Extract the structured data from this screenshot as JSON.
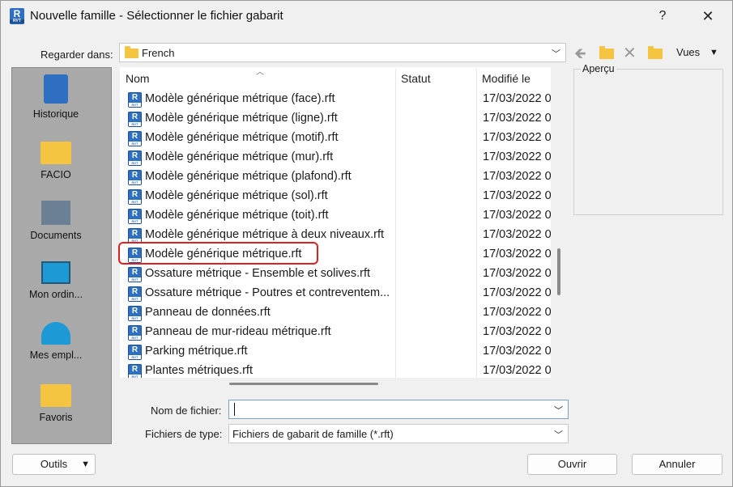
{
  "titlebar": {
    "title": "Nouvelle famille - Sélectionner le fichier gabarit",
    "help": "?",
    "close": "✕",
    "app_icon_letter": "R",
    "app_icon_sub": "RVT"
  },
  "lookin": {
    "label": "Regarder dans:",
    "value": "French"
  },
  "toolbar": {
    "views_label": "Vues"
  },
  "places": [
    {
      "label": "Historique",
      "icon": "history-icon"
    },
    {
      "label": "FACIO",
      "icon": "folder-icon"
    },
    {
      "label": "Documents",
      "icon": "documents-icon"
    },
    {
      "label": "Mon ordin...",
      "icon": "computer-icon"
    },
    {
      "label": "Mes empl...",
      "icon": "network-icon"
    },
    {
      "label": "Favoris",
      "icon": "folder-icon"
    }
  ],
  "columns": {
    "name": "Nom",
    "status": "Statut",
    "modified": "Modifié le"
  },
  "files": [
    {
      "name": "Modèle générique métrique (face).rft",
      "date": "17/03/2022 0"
    },
    {
      "name": "Modèle générique métrique (ligne).rft",
      "date": "17/03/2022 0"
    },
    {
      "name": "Modèle générique métrique (motif).rft",
      "date": "17/03/2022 0"
    },
    {
      "name": "Modèle générique métrique (mur).rft",
      "date": "17/03/2022 0"
    },
    {
      "name": "Modèle générique métrique (plafond).rft",
      "date": "17/03/2022 0"
    },
    {
      "name": "Modèle générique métrique (sol).rft",
      "date": "17/03/2022 0"
    },
    {
      "name": "Modèle générique métrique (toit).rft",
      "date": "17/03/2022 0"
    },
    {
      "name": "Modèle générique métrique à deux niveaux.rft",
      "date": "17/03/2022 0"
    },
    {
      "name": "Modèle générique métrique.rft",
      "date": "17/03/2022 0"
    },
    {
      "name": "Ossature métrique - Ensemble et solives.rft",
      "date": "17/03/2022 0"
    },
    {
      "name": "Ossature métrique - Poutres et contreventem...",
      "date": "17/03/2022 0"
    },
    {
      "name": "Panneau de données.rft",
      "date": "17/03/2022 0"
    },
    {
      "name": "Panneau de mur-rideau métrique.rft",
      "date": "17/03/2022 0"
    },
    {
      "name": "Parking métrique.rft",
      "date": "17/03/2022 0"
    },
    {
      "name": "Plantes métriques.rft",
      "date": "17/03/2022 0"
    }
  ],
  "preview": {
    "label": "Aperçu"
  },
  "filename": {
    "label": "Nom de fichier:",
    "value": ""
  },
  "filetype": {
    "label": "Fichiers de type:",
    "value": "Fichiers de gabarit de famille  (*.rft)"
  },
  "buttons": {
    "tools": "Outils",
    "open": "Ouvrir",
    "cancel": "Annuler"
  }
}
